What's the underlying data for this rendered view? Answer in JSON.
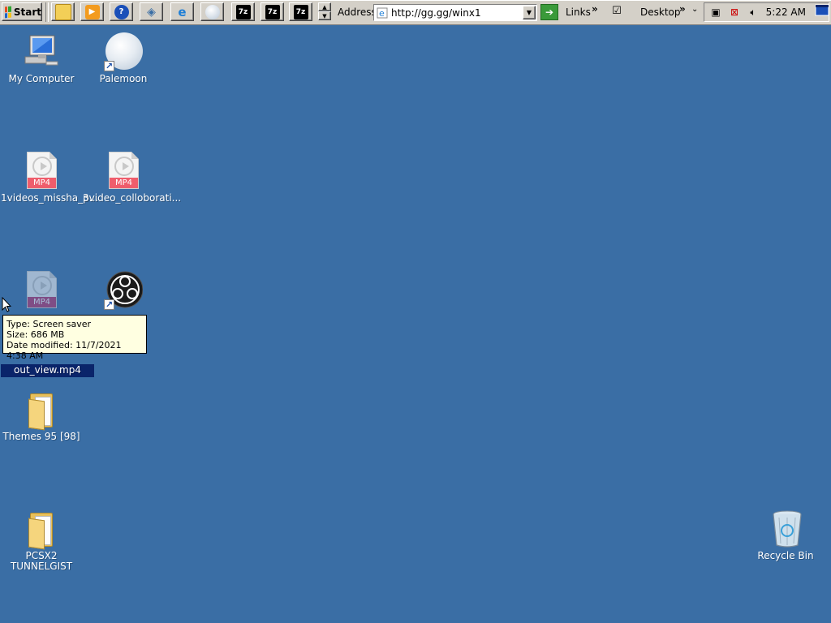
{
  "taskbar": {
    "start_label": "Start",
    "quicklaunch": [
      {
        "icon": "folder-explorer-icon"
      },
      {
        "icon": "media-player-icon"
      },
      {
        "icon": "help-icon"
      },
      {
        "icon": "network-icon"
      },
      {
        "icon": "internet-explorer-icon"
      },
      {
        "icon": "palemoon-icon"
      },
      {
        "icon": "7zip-icon",
        "label": "7z"
      },
      {
        "icon": "7zip-icon",
        "label": "7z"
      },
      {
        "icon": "7zip-icon",
        "label": "7z"
      }
    ],
    "address_label": "Address",
    "address_value": "http://gg.gg/winx1",
    "links_label": "Links",
    "desktop_label": "Desktop",
    "clock": "5:22 AM"
  },
  "desktop": {
    "icons": [
      {
        "label": "My Computer",
        "kind": "computer"
      },
      {
        "label": "Palemoon",
        "kind": "shortcut"
      },
      {
        "label": "1videos_missha_p...",
        "kind": "mp4"
      },
      {
        "label": "3video_colloborati...",
        "kind": "mp4"
      },
      {
        "label": "out_view.mp4",
        "kind": "mp4",
        "selected": true
      },
      {
        "label": "",
        "kind": "obs-shortcut"
      },
      {
        "label": "Themes 95 [98]",
        "kind": "folder"
      },
      {
        "label": "PCSX2\nTUNNELGIST",
        "kind": "folder"
      },
      {
        "label": "Recycle Bin",
        "kind": "recycle-bin"
      }
    ],
    "mp4_tag": "MP4"
  },
  "tooltip": {
    "line1": "Type: Screen saver",
    "line2": "Size: 686 MB",
    "line3": "Date modified: 11/7/2021 4:38 AM"
  }
}
